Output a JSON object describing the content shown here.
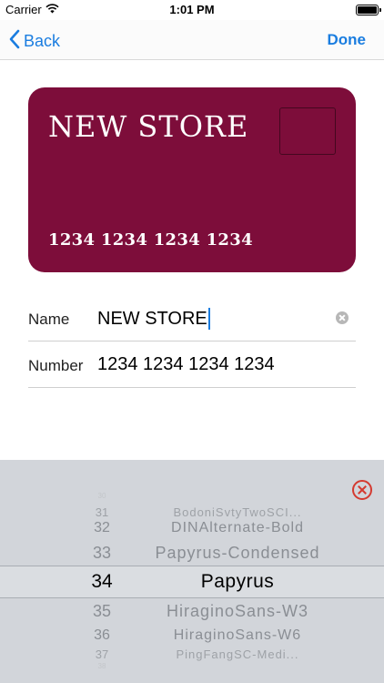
{
  "status_bar": {
    "carrier": "Carrier",
    "time": "1:01 PM"
  },
  "nav": {
    "back_label": "Back",
    "done_label": "Done"
  },
  "card": {
    "name": "NEW STORE",
    "number": "1234 1234 1234 1234",
    "color": "#7d0d3a"
  },
  "form": {
    "name_label": "Name",
    "name_value": "NEW STORE",
    "number_label": "Number",
    "number_value": "1234 1234 1234 1234"
  },
  "picker": {
    "rows": [
      {
        "num": "30",
        "font": ""
      },
      {
        "num": "31",
        "font": "BodoniSvtyTwoSCI..."
      },
      {
        "num": "32",
        "font": "DINAlternate-Bold"
      },
      {
        "num": "33",
        "font": "Papyrus-Condensed"
      },
      {
        "num": "34",
        "font": "Papyrus"
      },
      {
        "num": "35",
        "font": "HiraginoSans-W3"
      },
      {
        "num": "36",
        "font": "HiraginoSans-W6"
      },
      {
        "num": "37",
        "font": "PingFangSC-Medi..."
      },
      {
        "num": "38",
        "font": ""
      }
    ],
    "selected_index": 4
  },
  "colors": {
    "accent": "#1a7de0",
    "close": "#d43a30",
    "picker_bg": "#d2d5da"
  },
  "icons": [
    "wifi-icon",
    "battery-icon",
    "chevron-left-icon",
    "clear-icon",
    "close-circle-icon"
  ]
}
